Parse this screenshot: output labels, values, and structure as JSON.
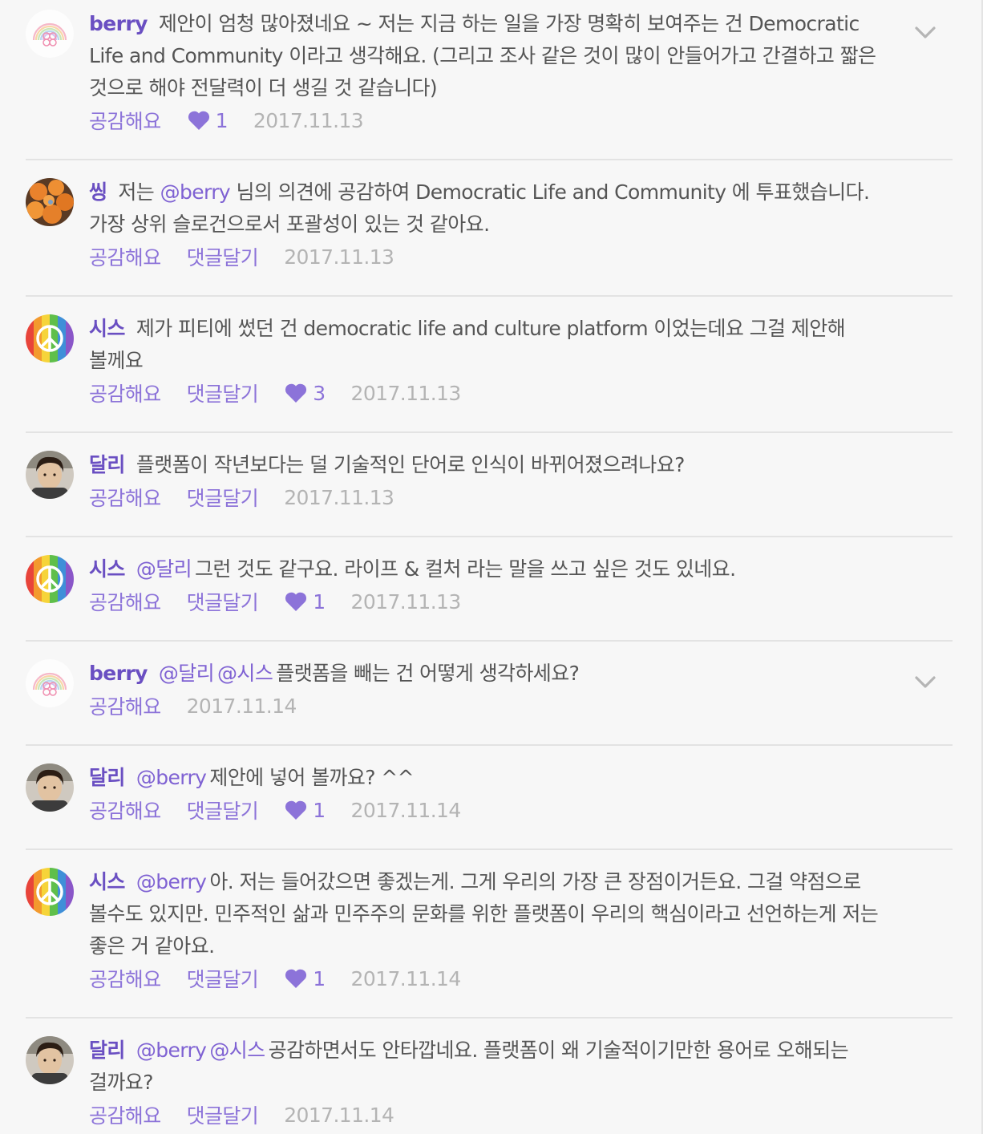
{
  "colors": {
    "author": "#6a4fc2",
    "link": "#8c73d9",
    "text": "#555555",
    "date": "#b4b4b4",
    "divider": "#e3e3e3",
    "background": "#f7f7f7"
  },
  "comments": [
    {
      "author": "berry",
      "mentions": [],
      "text": "제안이 엄청 많아졌네요 ~ 저는 지금 하는 일을 가장 명확히 보여주는 건 Democratic Life and Community 이라고 생각해요. (그리고 조사 같은 것이 많이 안들어가고 간결하고 짧은 것으로 해야 전달력이 더 생길 것 같습니다)",
      "like_label": "공감해요",
      "reply_label": "",
      "likes": "1",
      "date": "2017.11.13",
      "avatar": "rainbow-logo",
      "has_menu": true
    },
    {
      "author": "씽",
      "mentions": [],
      "text": "저는 @berry 님의 의견에 공감하여 Democratic Life and Community 에 투표했습니다. 가장 상위 슬로건으로서 포괄성이 있는 것 같아요.",
      "like_label": "공감해요",
      "reply_label": "댓글달기",
      "likes": "",
      "date": "2017.11.13",
      "avatar": "oranges",
      "has_menu": false
    },
    {
      "author": "시스",
      "mentions": [],
      "text": "제가 피티에 썼던 건 democratic life and culture platform 이었는데요 그걸 제안해 볼께요",
      "like_label": "공감해요",
      "reply_label": "댓글달기",
      "likes": "3",
      "date": "2017.11.13",
      "avatar": "peace-rainbow",
      "has_menu": false
    },
    {
      "author": "달리",
      "mentions": [],
      "text": "플랫폼이 작년보다는 덜 기술적인 단어로 인식이 바뀌어졌으려나요?",
      "like_label": "공감해요",
      "reply_label": "댓글달기",
      "likes": "",
      "date": "2017.11.13",
      "avatar": "person-photo",
      "has_menu": false
    },
    {
      "author": "시스",
      "mentions": [
        "@달리"
      ],
      "text": "그런 것도 같구요. 라이프 & 컬처 라는 말을 쓰고 싶은 것도 있네요.",
      "like_label": "공감해요",
      "reply_label": "댓글달기",
      "likes": "1",
      "date": "2017.11.13",
      "avatar": "peace-rainbow",
      "has_menu": false
    },
    {
      "author": "berry",
      "mentions": [
        "@달리",
        "@시스"
      ],
      "text": "플랫폼을 빼는 건 어떻게 생각하세요?",
      "like_label": "공감해요",
      "reply_label": "",
      "likes": "",
      "date": "2017.11.14",
      "avatar": "rainbow-logo",
      "has_menu": true
    },
    {
      "author": "달리",
      "mentions": [
        "@berry"
      ],
      "text": "제안에 넣어 볼까요? ^^",
      "like_label": "공감해요",
      "reply_label": "댓글달기",
      "likes": "1",
      "date": "2017.11.14",
      "avatar": "person-photo",
      "has_menu": false
    },
    {
      "author": "시스",
      "mentions": [
        "@berry"
      ],
      "text": "아. 저는 들어갔으면 좋겠는게. 그게 우리의 가장 큰 장점이거든요. 그걸 약점으로 볼수도 있지만. 민주적인 삶과 민주주의 문화를 위한 플랫폼이 우리의 핵심이라고 선언하는게 저는 좋은 거 같아요.",
      "like_label": "공감해요",
      "reply_label": "댓글달기",
      "likes": "1",
      "date": "2017.11.14",
      "avatar": "peace-rainbow",
      "has_menu": false
    },
    {
      "author": "달리",
      "mentions": [
        "@berry",
        "@시스"
      ],
      "text": "공감하면서도 안타깝네요. 플랫폼이 왜 기술적이기만한 용어로 오해되는 걸까요?",
      "like_label": "공감해요",
      "reply_label": "댓글달기",
      "likes": "",
      "date": "2017.11.14",
      "avatar": "person-photo",
      "has_menu": false
    }
  ]
}
